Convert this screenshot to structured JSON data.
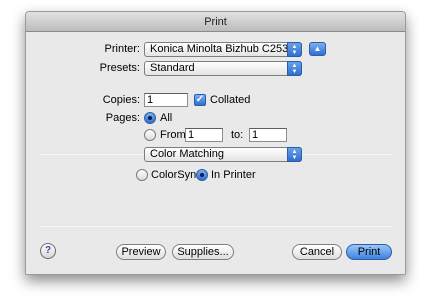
{
  "window": {
    "title": "Print"
  },
  "printer": {
    "label": "Printer:",
    "value": "Konica Minolta Bizhub C253"
  },
  "presets": {
    "label": "Presets:",
    "value": "Standard"
  },
  "copies": {
    "label": "Copies:",
    "value": "1",
    "collated_label": "Collated",
    "collated_checked": true
  },
  "pages": {
    "label": "Pages:",
    "all_label": "All",
    "from_label": "From:",
    "from_value": "1",
    "to_label": "to:",
    "to_value": "1",
    "selected": "All"
  },
  "panel": {
    "value": "Color Matching"
  },
  "color_matching": {
    "colorsync_label": "ColorSync",
    "in_printer_label": "In Printer",
    "selected": "In Printer"
  },
  "buttons": {
    "help": "?",
    "preview": "Preview",
    "supplies": "Supplies...",
    "cancel": "Cancel",
    "print": "Print"
  }
}
